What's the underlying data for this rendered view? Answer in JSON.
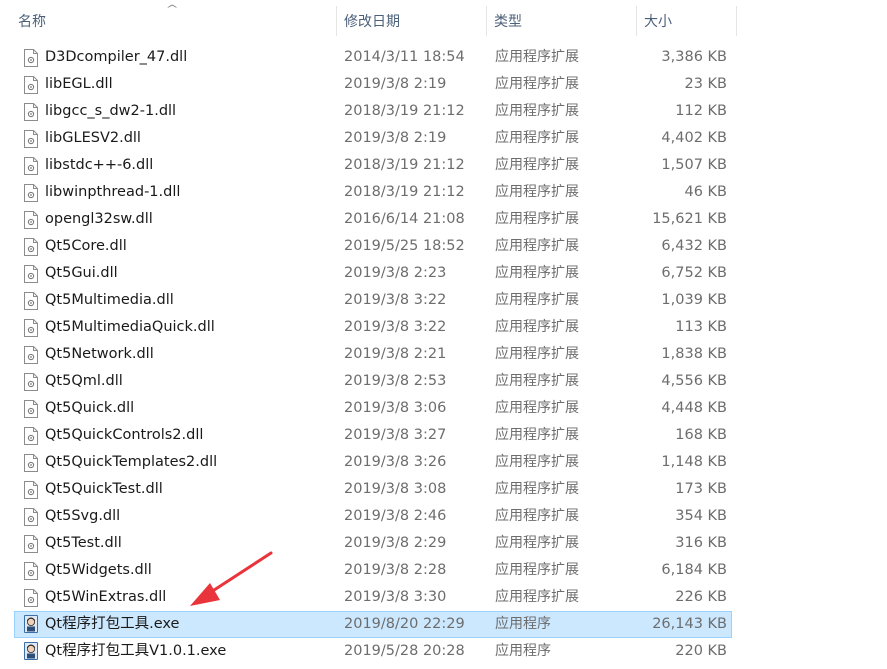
{
  "columns": {
    "name": "名称",
    "modified": "修改日期",
    "type": "类型",
    "size": "大小"
  },
  "files": [
    {
      "name": "D3Dcompiler_47.dll",
      "modified": "2014/3/11 18:54",
      "type": "应用程序扩展",
      "size": "3,386 KB",
      "icon": "dll-file-icon"
    },
    {
      "name": "libEGL.dll",
      "modified": "2019/3/8 2:19",
      "type": "应用程序扩展",
      "size": "23 KB",
      "icon": "dll-file-icon"
    },
    {
      "name": "libgcc_s_dw2-1.dll",
      "modified": "2018/3/19 21:12",
      "type": "应用程序扩展",
      "size": "112 KB",
      "icon": "dll-file-icon"
    },
    {
      "name": "libGLESV2.dll",
      "modified": "2019/3/8 2:19",
      "type": "应用程序扩展",
      "size": "4,402 KB",
      "icon": "dll-file-icon"
    },
    {
      "name": "libstdc++-6.dll",
      "modified": "2018/3/19 21:12",
      "type": "应用程序扩展",
      "size": "1,507 KB",
      "icon": "dll-file-icon"
    },
    {
      "name": "libwinpthread-1.dll",
      "modified": "2018/3/19 21:12",
      "type": "应用程序扩展",
      "size": "46 KB",
      "icon": "dll-file-icon"
    },
    {
      "name": "opengl32sw.dll",
      "modified": "2016/6/14 21:08",
      "type": "应用程序扩展",
      "size": "15,621 KB",
      "icon": "dll-file-icon"
    },
    {
      "name": "Qt5Core.dll",
      "modified": "2019/5/25 18:52",
      "type": "应用程序扩展",
      "size": "6,432 KB",
      "icon": "dll-file-icon"
    },
    {
      "name": "Qt5Gui.dll",
      "modified": "2019/3/8 2:23",
      "type": "应用程序扩展",
      "size": "6,752 KB",
      "icon": "dll-file-icon"
    },
    {
      "name": "Qt5Multimedia.dll",
      "modified": "2019/3/8 3:22",
      "type": "应用程序扩展",
      "size": "1,039 KB",
      "icon": "dll-file-icon"
    },
    {
      "name": "Qt5MultimediaQuick.dll",
      "modified": "2019/3/8 3:22",
      "type": "应用程序扩展",
      "size": "113 KB",
      "icon": "dll-file-icon"
    },
    {
      "name": "Qt5Network.dll",
      "modified": "2019/3/8 2:21",
      "type": "应用程序扩展",
      "size": "1,838 KB",
      "icon": "dll-file-icon"
    },
    {
      "name": "Qt5Qml.dll",
      "modified": "2019/3/8 2:53",
      "type": "应用程序扩展",
      "size": "4,556 KB",
      "icon": "dll-file-icon"
    },
    {
      "name": "Qt5Quick.dll",
      "modified": "2019/3/8 3:06",
      "type": "应用程序扩展",
      "size": "4,448 KB",
      "icon": "dll-file-icon"
    },
    {
      "name": "Qt5QuickControls2.dll",
      "modified": "2019/3/8 3:27",
      "type": "应用程序扩展",
      "size": "168 KB",
      "icon": "dll-file-icon"
    },
    {
      "name": "Qt5QuickTemplates2.dll",
      "modified": "2019/3/8 3:26",
      "type": "应用程序扩展",
      "size": "1,148 KB",
      "icon": "dll-file-icon"
    },
    {
      "name": "Qt5QuickTest.dll",
      "modified": "2019/3/8 3:08",
      "type": "应用程序扩展",
      "size": "173 KB",
      "icon": "dll-file-icon"
    },
    {
      "name": "Qt5Svg.dll",
      "modified": "2019/3/8 2:46",
      "type": "应用程序扩展",
      "size": "354 KB",
      "icon": "dll-file-icon"
    },
    {
      "name": "Qt5Test.dll",
      "modified": "2019/3/8 2:29",
      "type": "应用程序扩展",
      "size": "316 KB",
      "icon": "dll-file-icon"
    },
    {
      "name": "Qt5Widgets.dll",
      "modified": "2019/3/8 2:28",
      "type": "应用程序扩展",
      "size": "6,184 KB",
      "icon": "dll-file-icon"
    },
    {
      "name": "Qt5WinExtras.dll",
      "modified": "2019/3/8 3:30",
      "type": "应用程序扩展",
      "size": "226 KB",
      "icon": "dll-file-icon"
    },
    {
      "name": "Qt程序打包工具.exe",
      "modified": "2019/8/20 22:29",
      "type": "应用程序",
      "size": "26,143 KB",
      "icon": "app-avatar-icon",
      "selected": true
    },
    {
      "name": "Qt程序打包工具V1.0.1.exe",
      "modified": "2019/5/28 20:28",
      "type": "应用程序",
      "size": "220 KB",
      "icon": "app-avatar-icon"
    }
  ],
  "colors": {
    "selection_bg": "#cce8ff",
    "selection_border": "#99d1ff",
    "annotation_arrow": "#e8343a"
  }
}
